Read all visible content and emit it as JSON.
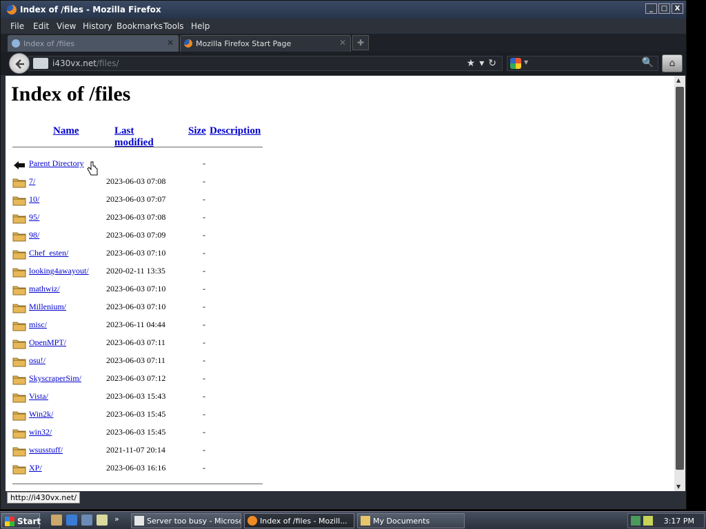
{
  "window": {
    "title": "Index of /files - Mozilla Firefox"
  },
  "window_buttons": {
    "minimize": "_",
    "maximize": "□",
    "close": "X"
  },
  "menu": [
    "File",
    "Edit",
    "View",
    "History",
    "Bookmarks",
    "Tools",
    "Help"
  ],
  "tabs": [
    {
      "label": "Index of /files",
      "active": true
    },
    {
      "label": "Mozilla Firefox Start Page",
      "active": false
    }
  ],
  "urlbar": {
    "host": "i430vx.net",
    "path": "/files/"
  },
  "page": {
    "heading": "Index of /files",
    "columns": {
      "name": "Name",
      "modified": "Last modified",
      "size": "Size",
      "description": "Description"
    },
    "parent": {
      "name": "Parent Directory",
      "size": "-"
    },
    "rows": [
      {
        "name": "7/",
        "modified": "2023-06-03 07:08",
        "size": "-"
      },
      {
        "name": "10/",
        "modified": "2023-06-03 07:07",
        "size": "-"
      },
      {
        "name": "95/",
        "modified": "2023-06-03 07:08",
        "size": "-"
      },
      {
        "name": "98/",
        "modified": "2023-06-03 07:09",
        "size": "-"
      },
      {
        "name": "Chef_esten/",
        "modified": "2023-06-03 07:10",
        "size": "-"
      },
      {
        "name": "looking4awayout/",
        "modified": "2020-02-11 13:35",
        "size": "-"
      },
      {
        "name": "mathwiz/",
        "modified": "2023-06-03 07:10",
        "size": "-"
      },
      {
        "name": "Millenium/",
        "modified": "2023-06-03 07:10",
        "size": "-"
      },
      {
        "name": "misc/",
        "modified": "2023-06-11 04:44",
        "size": "-"
      },
      {
        "name": "OpenMPT/",
        "modified": "2023-06-03 07:11",
        "size": "-"
      },
      {
        "name": "osu!/",
        "modified": "2023-06-03 07:11",
        "size": "-"
      },
      {
        "name": "SkyscraperSim/",
        "modified": "2023-06-03 07:12",
        "size": "-"
      },
      {
        "name": "Vista/",
        "modified": "2023-06-03 15:43",
        "size": "-"
      },
      {
        "name": "Win2k/",
        "modified": "2023-06-03 15:45",
        "size": "-"
      },
      {
        "name": "win32/",
        "modified": "2023-06-03 15:45",
        "size": "-"
      },
      {
        "name": "wsusstuff/",
        "modified": "2021-11-07 20:14",
        "size": "-"
      },
      {
        "name": "XP/",
        "modified": "2023-06-03 16:16",
        "size": "-"
      }
    ]
  },
  "status": {
    "text": "http://i430vx.net/"
  },
  "taskbar": {
    "start_label": "Start",
    "items": [
      {
        "label": "Server too busy - Microso...",
        "active": false
      },
      {
        "label": "Index of /files - Mozill...",
        "active": true
      },
      {
        "label": "My Documents",
        "active": false
      }
    ],
    "clock": "3:17 PM"
  },
  "icons": {
    "folder": "folder-icon",
    "parent": "parent-directory-icon",
    "back": "back-arrow-icon",
    "bookmark": "star-icon",
    "reload": "reload-icon",
    "search": "magnifier-icon",
    "home": "home-icon"
  },
  "colors": {
    "link": "#0000cc",
    "chrome": "#2a2f38",
    "titlebar": "#26344b"
  }
}
